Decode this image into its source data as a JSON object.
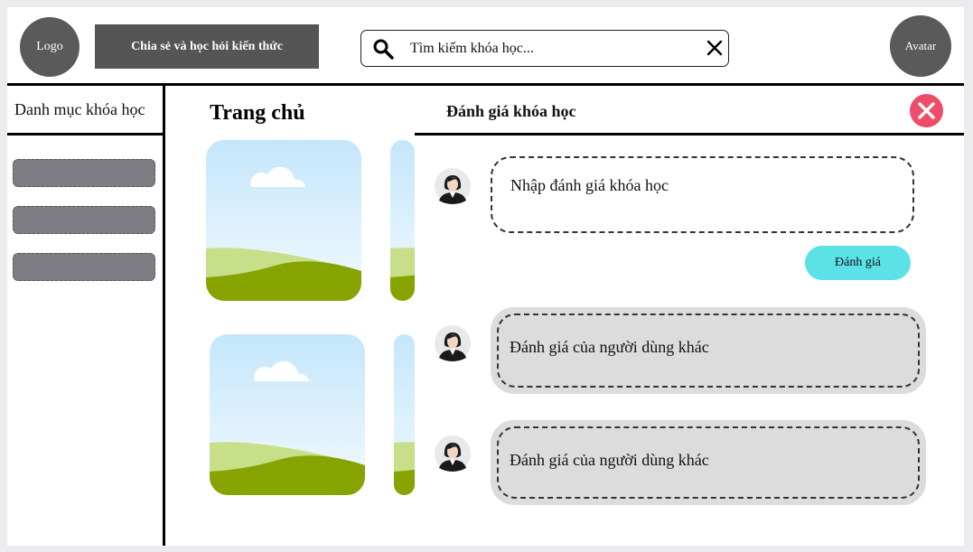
{
  "header": {
    "logo_label": "Logo",
    "banner_label": "Chia sẻ và học hỏi kiến thức",
    "search_placeholder": "Tìm kiếm khóa học...",
    "avatar_label": "Avatar"
  },
  "sidebar": {
    "title": "Danh mục khóa học",
    "item_count": 3
  },
  "main": {
    "title": "Trang chủ"
  },
  "review_panel": {
    "title": "Đánh giá khóa học",
    "input_placeholder": "Nhập đánh giá khóa học",
    "submit_label": "Đánh giá",
    "reviews": [
      {
        "text": "Đánh giá của người dùng khác"
      },
      {
        "text": "Đánh giá của người dùng khác"
      }
    ]
  },
  "colors": {
    "close_button": "#ee4d6a",
    "submit_button": "#5be1e6",
    "sidebar_item": "#7d7d83",
    "review_background": "#dcdcdc"
  }
}
